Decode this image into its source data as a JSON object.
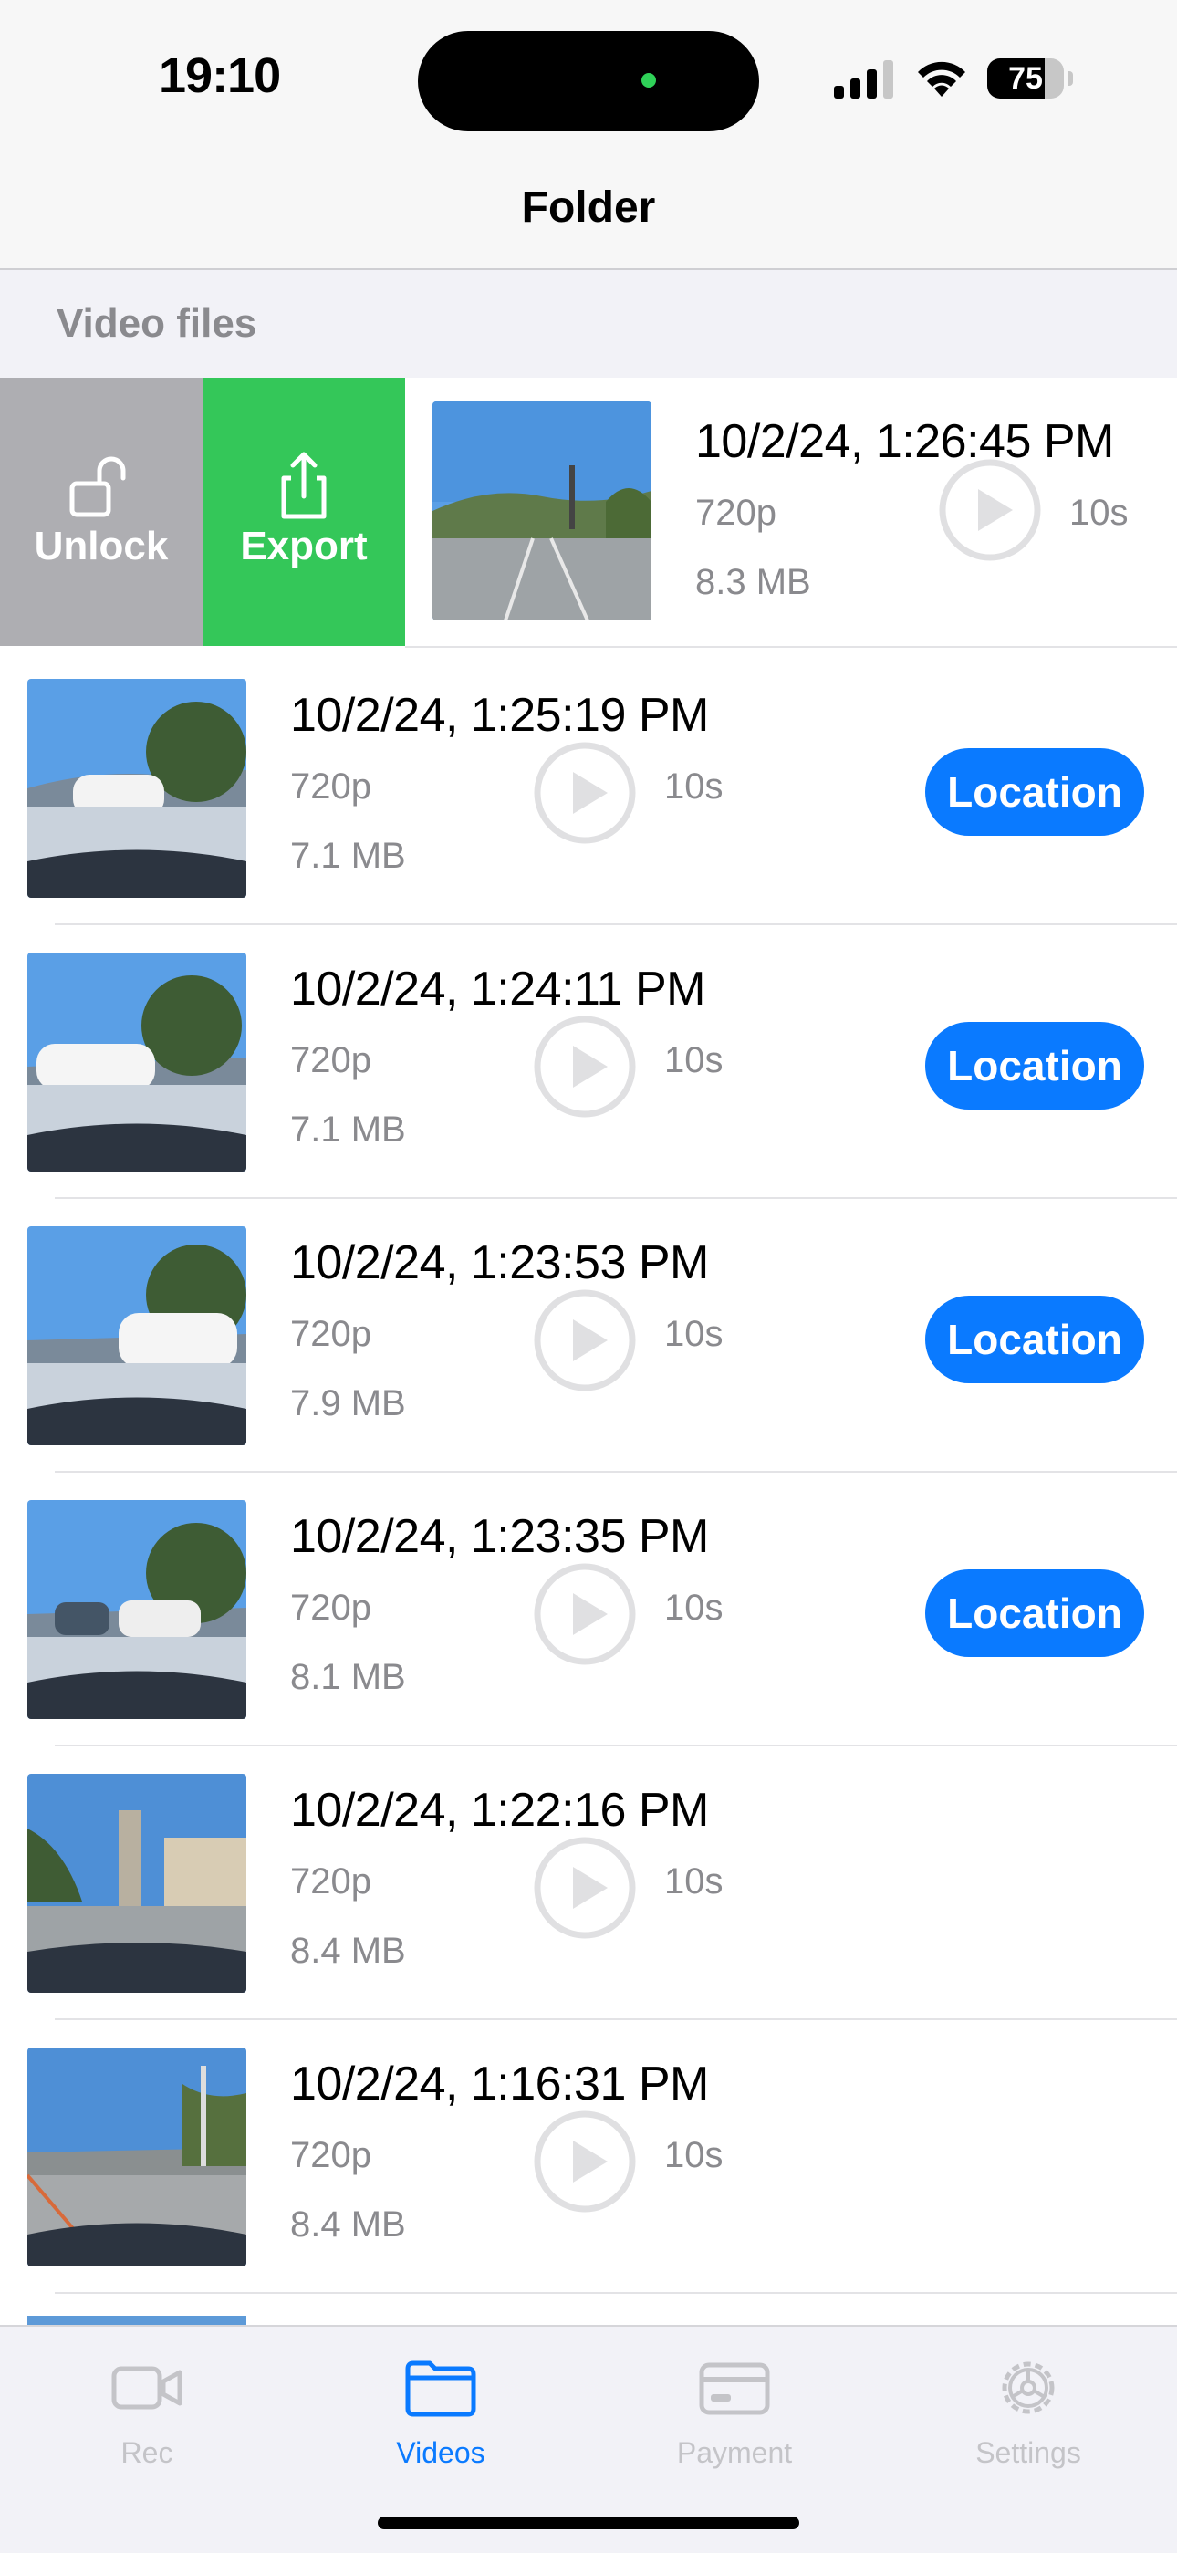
{
  "status_bar": {
    "time": "19:10",
    "battery": "75",
    "battery_level": 0.75,
    "signal_icon": "cellular-signal-icon",
    "wifi_icon": "wifi-icon"
  },
  "nav": {
    "title": "Folder"
  },
  "section": {
    "title": "Video files"
  },
  "swipe_actions": {
    "unlock_label": "Unlock",
    "export_label": "Export",
    "unlock_icon": "unlock-icon",
    "export_icon": "share-icon",
    "unlock_color": "#aeaeb2",
    "export_color": "#34c759"
  },
  "videos": [
    {
      "datetime": "10/2/24, 1:26:45 PM",
      "resolution": "720p",
      "size": "8.3 MB",
      "duration": "10s",
      "location_label": ""
    },
    {
      "datetime": "10/2/24, 1:25:19 PM",
      "resolution": "720p",
      "size": "7.1 MB",
      "duration": "10s",
      "location_label": "Location"
    },
    {
      "datetime": "10/2/24, 1:24:11 PM",
      "resolution": "720p",
      "size": "7.1 MB",
      "duration": "10s",
      "location_label": "Location"
    },
    {
      "datetime": "10/2/24, 1:23:53 PM",
      "resolution": "720p",
      "size": "7.9 MB",
      "duration": "10s",
      "location_label": "Location"
    },
    {
      "datetime": "10/2/24, 1:23:35 PM",
      "resolution": "720p",
      "size": "8.1 MB",
      "duration": "10s",
      "location_label": "Location"
    },
    {
      "datetime": "10/2/24, 1:22:16 PM",
      "resolution": "720p",
      "size": "8.4 MB",
      "duration": "10s",
      "location_label": ""
    },
    {
      "datetime": "10/2/24, 1:16:31 PM",
      "resolution": "720p",
      "size": "8.4 MB",
      "duration": "10s",
      "location_label": ""
    }
  ],
  "tabs": [
    {
      "label": "Rec",
      "icon": "video-camera-icon",
      "active": false
    },
    {
      "label": "Videos",
      "icon": "folder-icon",
      "active": true
    },
    {
      "label": "Payment",
      "icon": "credit-card-icon",
      "active": false
    },
    {
      "label": "Settings",
      "icon": "gear-icon",
      "active": false
    }
  ],
  "colors": {
    "accent": "#0a7aff",
    "secondary_text": "#8a8a8e",
    "inactive_tab": "#c4c4c8"
  }
}
